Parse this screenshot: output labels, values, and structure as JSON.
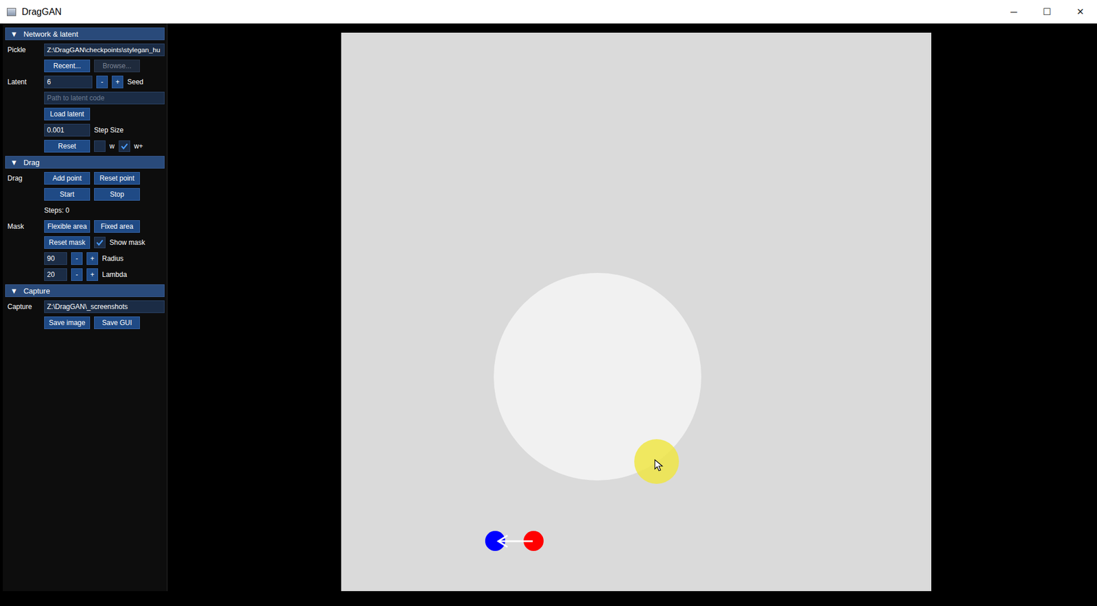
{
  "window": {
    "title": "DragGAN",
    "controls": [
      "─",
      "☐",
      "✕"
    ]
  },
  "network": {
    "header": "Network & latent",
    "expand_icon": "▼",
    "expanded": true,
    "pickle_label": "Pickle",
    "pickle_value": "Z:\\DragGAN\\checkpoints\\stylegan_hu",
    "recent_button": "Recent...",
    "browse_button": {
      "label": "Browse...",
      "disabled": true
    },
    "latent_label": "Latent",
    "seed_value": "6",
    "minus": "-",
    "plus": "+",
    "seed_label": "Seed",
    "latent_path_placeholder": "Path to latent code",
    "load_latent": "Load latent",
    "step_size_value": "0.001",
    "step_size_label": "Step Size",
    "reset": "Reset",
    "options": [
      {
        "label": "w",
        "checked": false
      },
      {
        "label": "w+",
        "checked": true
      }
    ]
  },
  "drag": {
    "header": "Drag",
    "expand_icon": "▼",
    "expanded": true,
    "label": "Drag",
    "buttons": [
      [
        "Add point",
        "Reset point"
      ],
      [
        "Start",
        "Stop"
      ]
    ],
    "steps": "Steps: 0",
    "mask_label": "Mask",
    "mask_buttons": [
      "Flexible area",
      "Fixed area"
    ],
    "reset_mask": "Reset mask",
    "show_mask": {
      "label": "Show mask",
      "checked": true
    },
    "spinners": [
      {
        "value": "90",
        "label": "Radius"
      },
      {
        "value": "20",
        "label": "Lambda"
      }
    ],
    "minus": "-",
    "plus": "+"
  },
  "capture": {
    "header": "Capture",
    "expand_icon": "▼",
    "expanded": true,
    "label": "Capture",
    "path": "Z:\\DragGAN\\_screenshots",
    "buttons": [
      "Save image",
      "Save GUI"
    ]
  },
  "canvas": {
    "mask_visible": true,
    "cursor_highlight": true,
    "points": [
      {
        "kind": "handle",
        "color": "#ff0000"
      },
      {
        "kind": "target",
        "color": "#0000ff"
      }
    ]
  }
}
